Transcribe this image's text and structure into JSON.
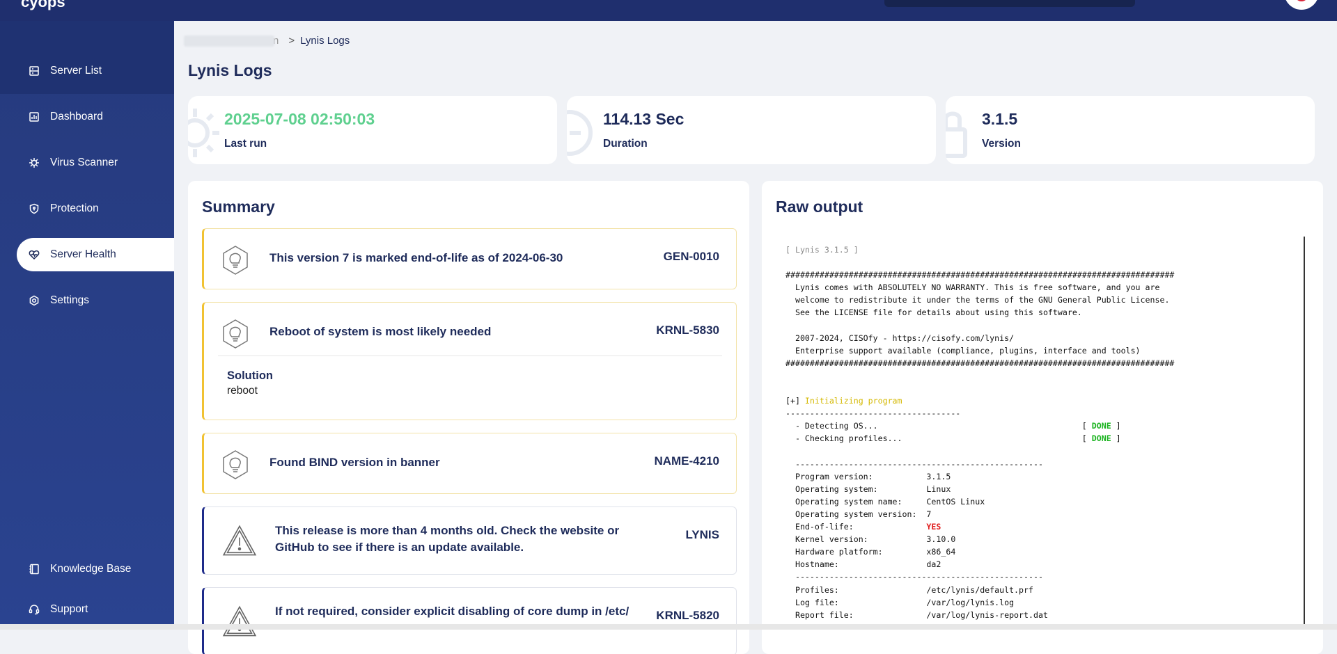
{
  "header": {
    "logo_text": "cyops"
  },
  "sidebar": {
    "items": [
      {
        "label": "Server List",
        "icon": "server-list-icon"
      },
      {
        "label": "Dashboard",
        "icon": "dashboard-icon"
      },
      {
        "label": "Virus Scanner",
        "icon": "virus-icon"
      },
      {
        "label": "Protection",
        "icon": "shield-icon"
      },
      {
        "label": "Server Health",
        "icon": "heart-icon",
        "active": true
      },
      {
        "label": "Settings",
        "icon": "gear-icon"
      }
    ],
    "bottom_items": [
      {
        "label": "Knowledge Base",
        "icon": "book-icon"
      },
      {
        "label": "Support",
        "icon": "headset-icon"
      }
    ]
  },
  "breadcrumb": {
    "tail": "n",
    "current": "Lynis Logs",
    "separator": ">"
  },
  "page": {
    "title": "Lynis Logs"
  },
  "stats": [
    {
      "value": "2025-07-08 02:50:03",
      "label": "Last run",
      "color": "#5fd08f"
    },
    {
      "value": "114.13 Sec",
      "label": "Duration",
      "color": "#1e2b5a"
    },
    {
      "value": "3.1.5",
      "label": "Version",
      "color": "#1e2b5a"
    }
  ],
  "summary": {
    "title": "Summary",
    "items": [
      {
        "text": "This version 7 is marked end-of-life as of 2024-06-30",
        "code": "GEN-0010",
        "type": "warning"
      },
      {
        "text": "Reboot of system is most likely needed",
        "code": "KRNL-5830",
        "type": "warning",
        "solution_title": "Solution",
        "solution": "reboot"
      },
      {
        "text": "Found BIND version in banner",
        "code": "NAME-4210",
        "type": "warning"
      },
      {
        "text": "This release is more than 4 months old. Check the website or GitHub to see if there is an update available.",
        "code": "LYNIS",
        "type": "info"
      },
      {
        "text": "If not required, consider explicit disabling of core dump in /etc/",
        "code": "KRNL-5820",
        "type": "info"
      }
    ]
  },
  "raw_output": {
    "title": "Raw output",
    "lines": {
      "header": "[ Lynis 3.1.5 ]",
      "hashes": "################################################################################",
      "l1": "  Lynis comes with ABSOLUTELY NO WARRANTY. This is free software, and you are",
      "l2": "  welcome to redistribute it under the terms of the GNU General Public License.",
      "l3": "  See the LICENSE file for details about using this software.",
      "l4": "  2007-2024, CISOfy - https://cisofy.com/lynis/",
      "l5": "  Enterprise support available (compliance, plugins, interface and tools)",
      "init_prefix": "[+] ",
      "init": "Initializing program",
      "dashes1": "------------------------------------",
      "detect": "  - Detecting OS...                                          [ ",
      "checkp": "  - Checking profiles...                                     [ ",
      "done": "DONE",
      "close": " ]",
      "dashes2": "  ---------------------------------------------------",
      "pv": "  Program version:           3.1.5",
      "os": "  Operating system:          Linux",
      "osn": "  Operating system name:     CentOS Linux",
      "osv": "  Operating system version:  7",
      "eol_label": "  End-of-life:               ",
      "eol": "YES",
      "kv": "  Kernel version:            3.10.0",
      "hp": "  Hardware platform:         x86_64",
      "hn": "  Hostname:                  da2",
      "prof": "  Profiles:                  /etc/lynis/default.prf",
      "log": "  Log file:                  /var/log/lynis.log",
      "rep": "  Report file:               /var/log/lynis-report.dat"
    }
  }
}
